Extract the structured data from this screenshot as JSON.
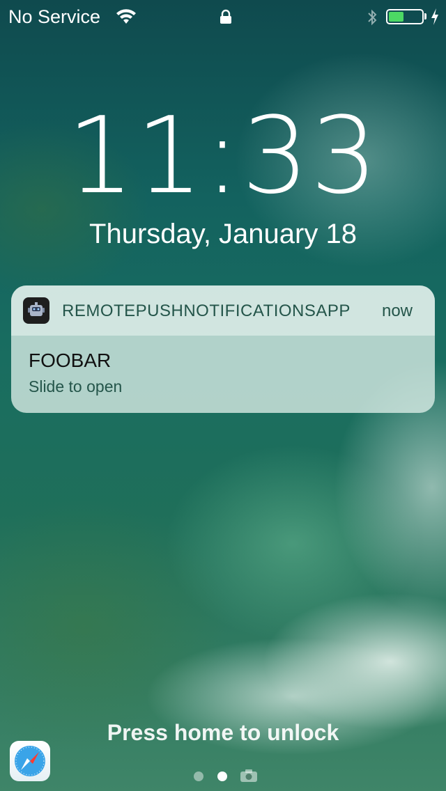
{
  "status_bar": {
    "carrier": "No Service",
    "wifi_icon": "wifi-icon",
    "lock_icon": "lock-icon",
    "bluetooth_icon": "bluetooth-icon",
    "battery_level": 0.45,
    "battery_color": "#4cd964",
    "charging_icon": "bolt-icon"
  },
  "lockscreen": {
    "time": "11:33",
    "date": "Thursday, January 18"
  },
  "notification": {
    "app_name": "REMOTEPUSHNOTIFICATIONSAPP",
    "time": "now",
    "title": "FOOBAR",
    "subtitle": "Slide to open"
  },
  "bottom": {
    "unlock_text": "Press home to unlock",
    "page_index": 2,
    "page_count": 3
  }
}
